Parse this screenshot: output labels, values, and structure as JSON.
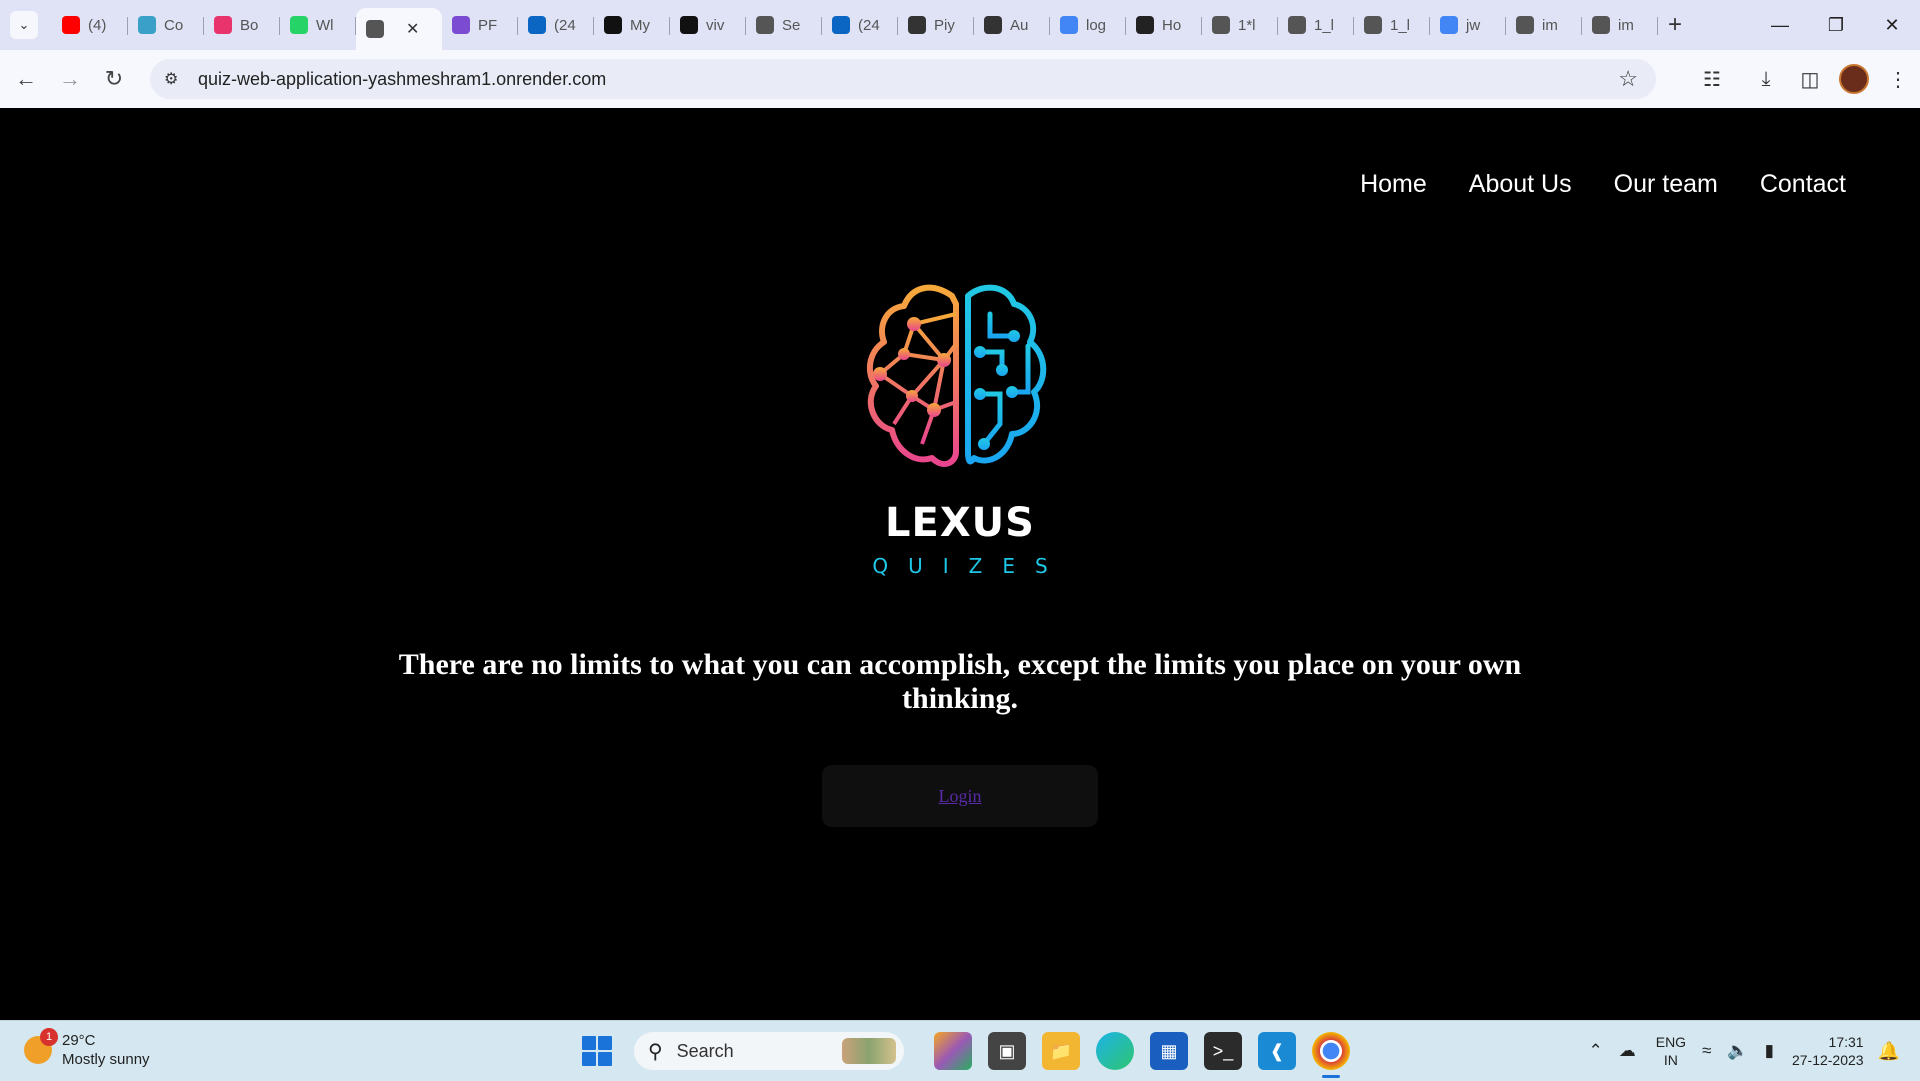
{
  "browser": {
    "tabs": [
      {
        "title": "(4)",
        "icon": "youtube-icon",
        "color": "#ff0000"
      },
      {
        "title": "Co",
        "icon": "chat-icon",
        "color": "#3aa0c8"
      },
      {
        "title": "Bo",
        "icon": "cube-icon",
        "color": "#e8336d"
      },
      {
        "title": "Wl",
        "icon": "whatsapp-icon",
        "color": "#25d366"
      },
      {
        "title": "",
        "icon": "globe-icon",
        "color": "#555555",
        "active": true
      },
      {
        "title": "PF",
        "icon": "link-icon",
        "color": "#7b4bd1"
      },
      {
        "title": "(24",
        "icon": "linkedin-icon",
        "color": "#0a66c2"
      },
      {
        "title": "My",
        "icon": "app-icon",
        "color": "#111111"
      },
      {
        "title": "viv",
        "icon": "github-icon",
        "color": "#111111"
      },
      {
        "title": "Se",
        "icon": "globe-icon",
        "color": "#555555"
      },
      {
        "title": "(24",
        "icon": "linkedin-icon",
        "color": "#0a66c2"
      },
      {
        "title": "Piy",
        "icon": "globe-icon",
        "color": "#333333"
      },
      {
        "title": "Au",
        "icon": "globe-icon",
        "color": "#333333"
      },
      {
        "title": "log",
        "icon": "google-icon",
        "color": "#4285f4"
      },
      {
        "title": "Ho",
        "icon": "shield-icon",
        "color": "#222222"
      },
      {
        "title": "1*l",
        "icon": "globe-icon",
        "color": "#555555"
      },
      {
        "title": "1_l",
        "icon": "globe-icon",
        "color": "#555555"
      },
      {
        "title": "1_l",
        "icon": "globe-icon",
        "color": "#555555"
      },
      {
        "title": "jw",
        "icon": "google-icon",
        "color": "#4285f4"
      },
      {
        "title": "im",
        "icon": "globe-icon",
        "color": "#555555"
      },
      {
        "title": "im",
        "icon": "globe-icon",
        "color": "#555555"
      }
    ],
    "url": "quiz-web-application-yashmeshram1.onrender.com"
  },
  "site": {
    "nav": [
      "Home",
      "About Us",
      "Our team",
      "Contact"
    ],
    "brand": "LEXUS",
    "tagline": "QUIZES",
    "quote": "There are no limits to what you can accomplish, except the limits you place on your own thinking.",
    "login_label": "Login",
    "colors": {
      "accent_cyan": "#1ec7e6",
      "brain_left_top": "#f6a23a",
      "brain_left_bottom": "#ec4c8d",
      "link": "#5a2aa6"
    }
  },
  "taskbar": {
    "weather_temp": "29°C",
    "weather_desc": "Mostly sunny",
    "weather_badge": "1",
    "search_label": "Search",
    "lang_line1": "ENG",
    "lang_line2": "IN",
    "time": "17:31",
    "date": "27-12-2023"
  }
}
